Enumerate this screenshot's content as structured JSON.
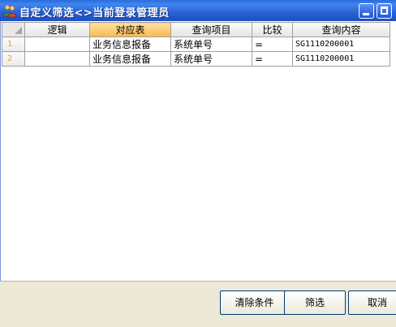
{
  "window": {
    "title": "自定义筛选<>当前登录管理员"
  },
  "grid": {
    "columns": [
      "逻辑",
      "对应表",
      "查询项目",
      "比较",
      "查询内容"
    ],
    "rows": [
      {
        "num": "1",
        "logic": "",
        "table": "业务信息报备",
        "item": "系统单号",
        "compare": "=",
        "value": "SG1110200001"
      },
      {
        "num": "2",
        "logic": "",
        "table": "业务信息报备",
        "item": "系统单号",
        "compare": "=",
        "value": "SG1110200001"
      }
    ]
  },
  "buttons": {
    "clear": "清除条件",
    "filter": "筛选",
    "cancel": "取消"
  }
}
